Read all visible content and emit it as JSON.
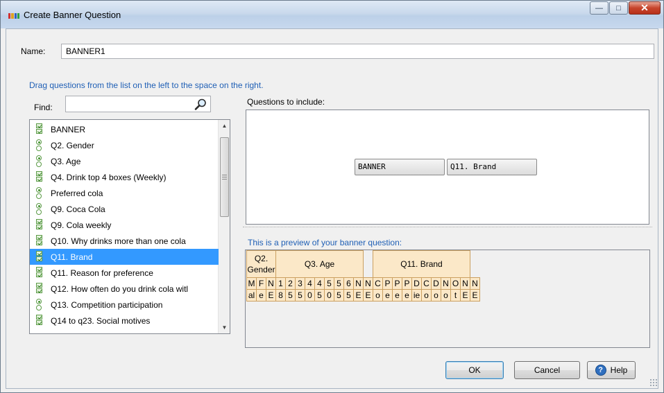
{
  "window": {
    "title": "Create Banner Question",
    "icon_colors": [
      "#d03030",
      "#e0a020",
      "#3060c0",
      "#30a040"
    ]
  },
  "name_field": {
    "label": "Name:",
    "value": "BANNER1"
  },
  "instruction": "Drag questions from the list on the left to the space on the right.",
  "find": {
    "label": "Find:",
    "value": ""
  },
  "questions": [
    {
      "label": "BANNER",
      "icon": "multi-check-icon"
    },
    {
      "label": "Q2. Gender",
      "icon": "single-radio-icon"
    },
    {
      "label": "Q3. Age",
      "icon": "single-radio-icon"
    },
    {
      "label": "Q4.  Drink top 4 boxes (Weekly)",
      "icon": "multi-check-icon"
    },
    {
      "label": "Preferred cola",
      "icon": "single-radio-icon"
    },
    {
      "label": "Q9. Coca Cola",
      "icon": "single-radio-icon"
    },
    {
      "label": "Q9.  Cola weekly",
      "icon": "multi-check-icon"
    },
    {
      "label": "Q10. Why drinks more than one cola",
      "icon": "multi-check-icon"
    },
    {
      "label": "Q11.  Brand",
      "icon": "multi-check-icon",
      "selected": true
    },
    {
      "label": "Q11.  Reason for preference",
      "icon": "multi-check-icon"
    },
    {
      "label": "Q12. How  often do you drink cola witl",
      "icon": "multi-check-icon"
    },
    {
      "label": "Q13. Competition participation",
      "icon": "single-radio-icon"
    },
    {
      "label": "Q14 to q23.  Social motives",
      "icon": "multi-check-icon"
    }
  ],
  "include": {
    "label": "Questions to include:",
    "chips": [
      "BANNER",
      "Q11. Brand"
    ]
  },
  "preview": {
    "label": "This is a preview of your banner question:",
    "groups": [
      {
        "title": "Q2.\nGender",
        "cols": [
          [
            "M",
            "al"
          ],
          [
            "F",
            "e"
          ],
          [
            "N",
            "E"
          ]
        ]
      },
      {
        "title": "Q3. Age",
        "cols": [
          [
            "1",
            "8"
          ],
          [
            "2",
            "5"
          ],
          [
            "3",
            "5"
          ],
          [
            "4",
            "0"
          ],
          [
            "4",
            "5"
          ],
          [
            "5",
            "0"
          ],
          [
            "5",
            "5"
          ],
          [
            "6",
            "5"
          ],
          [
            "N",
            "E"
          ]
        ]
      },
      {
        "title": "",
        "cols": [
          [
            "N",
            "E"
          ]
        ]
      },
      {
        "title": "Q11.  Brand",
        "cols": [
          [
            "C",
            "o"
          ],
          [
            "P",
            "e"
          ],
          [
            "P",
            "e"
          ],
          [
            "P",
            "e"
          ],
          [
            "D",
            "ie"
          ],
          [
            "C",
            "o"
          ],
          [
            "D",
            "o"
          ],
          [
            "N",
            "o"
          ],
          [
            "O",
            "t"
          ],
          [
            "N",
            "E"
          ]
        ]
      },
      {
        "title": "",
        "cols": [
          [
            "N",
            "E"
          ]
        ]
      }
    ]
  },
  "buttons": {
    "ok": "OK",
    "cancel": "Cancel",
    "help": "Help"
  }
}
